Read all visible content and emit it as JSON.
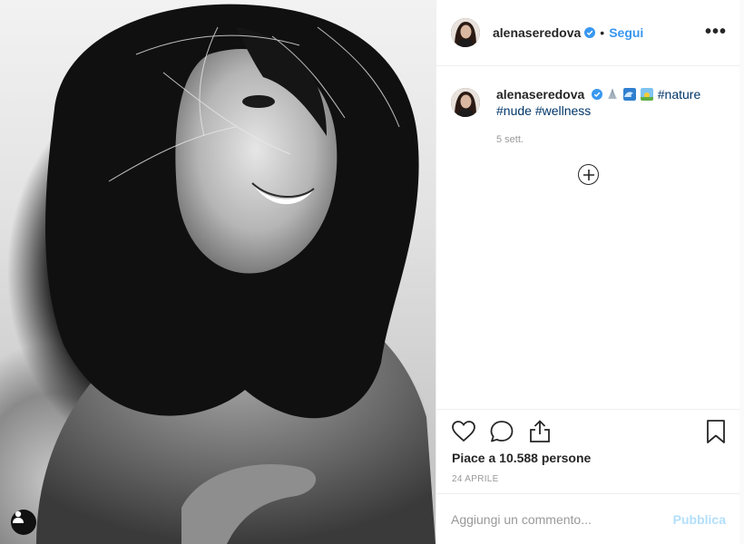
{
  "post": {
    "username": "alenaseredova",
    "follow_label": "Segui",
    "separator": "•",
    "more_label": "•••",
    "caption": {
      "username": "alenaseredova",
      "hashtags_line1": "#nature",
      "hashtags_line2_a": "#nude",
      "hashtags_line2_b": "#wellness",
      "emojis": [
        "shell-emoji",
        "wave-emoji",
        "sunrise-emoji"
      ],
      "time": "5 sett."
    },
    "likes_text": "Piace a 10.588 persone",
    "date": "24 APRILE",
    "comment_placeholder": "Aggiungi un commento...",
    "publish_label": "Pubblica"
  },
  "icons": {
    "like": "heart-icon",
    "comment": "comment-icon",
    "share": "share-icon",
    "save": "bookmark-icon",
    "load_more": "plus-circle-icon",
    "verified": "verified-badge-icon",
    "profile": "user-icon"
  },
  "colors": {
    "accent": "#3897f0",
    "hashtag": "#003569",
    "publish_disabled": "#b2dffc",
    "muted": "#999999"
  }
}
